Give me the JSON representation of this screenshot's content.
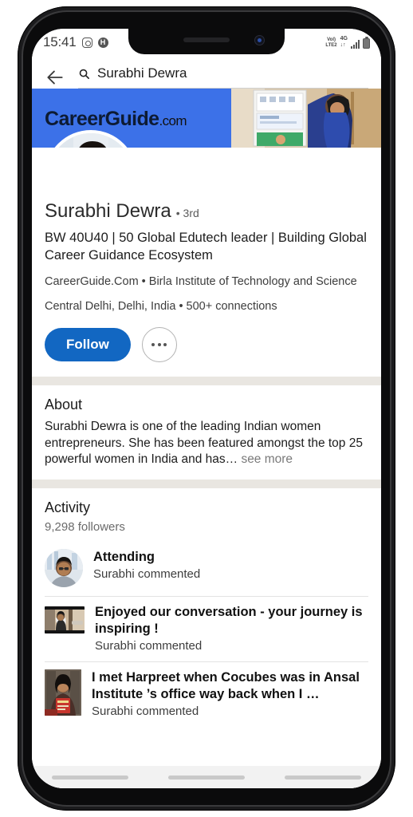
{
  "status_bar": {
    "time": "15:41",
    "instagram_icon": "instagram-icon",
    "app_icon_label": "H",
    "volte_line1": "Vol)",
    "volte_line2": "LTE2",
    "network": "4G",
    "data_arrows": "↓↑",
    "signal": "signal-bars-icon",
    "battery": "battery-icon"
  },
  "search": {
    "back_icon": "back-arrow-icon",
    "search_icon": "search-icon",
    "query": "Surabhi Dewra"
  },
  "banner": {
    "logo_main": "CareerGuide",
    "logo_suffix": ".com",
    "background_color": "#3c71e8"
  },
  "profile": {
    "avatar": "profile-avatar",
    "name": "Surabhi Dewra",
    "degree": "• 3rd",
    "headline": "BW 40U40 | 50 Global Edutech leader |  Building Global Career Guidance Ecosystem",
    "company_education": "CareerGuide.Com • Birla Institute of Technology and Science",
    "location_connections": "Central Delhi, Delhi, India • 500+ connections",
    "follow_label": "Follow",
    "more_label": "More options",
    "accent_color": "#1267c2"
  },
  "about": {
    "title": "About",
    "text": "Surabhi Dewra is one of the leading Indian women entrepreneurs. She has been featured amongst the top 25 powerful women in India and has",
    "ellipsis": "… ",
    "see_more": "see more"
  },
  "activity": {
    "title": "Activity",
    "followers": "9,298 followers",
    "items": [
      {
        "thumb_type": "round",
        "title": "Attending",
        "subtitle": "Surabhi commented"
      },
      {
        "thumb_type": "rect",
        "title": "Enjoyed our conversation - your journey is inspiring !",
        "subtitle": "Surabhi commented"
      },
      {
        "thumb_type": "portrait",
        "title": "I met Harpreet when Cocubes was in Ansal Institute ’s office way back when I …",
        "subtitle": "Surabhi commented"
      }
    ]
  },
  "nav_bar": {
    "pill_left": "recent-apps",
    "pill_center": "home",
    "pill_right": "back"
  }
}
